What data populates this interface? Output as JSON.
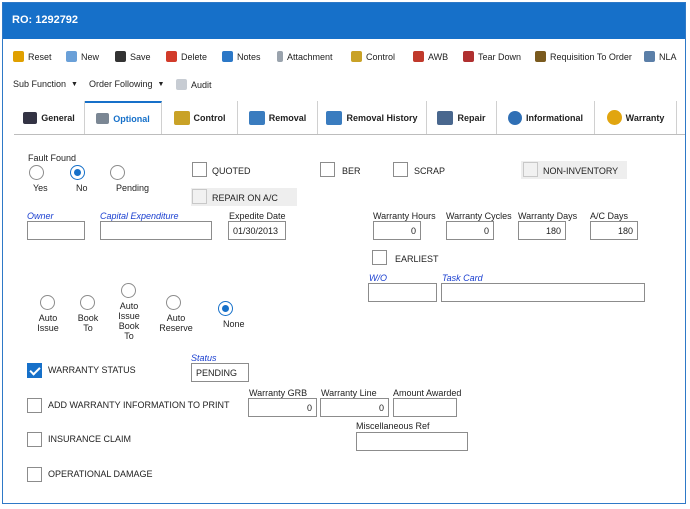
{
  "window": {
    "title": "RO: 1292792",
    "corner_glyph": "("
  },
  "toolbar": {
    "row1": [
      "Reset",
      "New",
      "Save",
      "Delete",
      "Notes",
      "Attachment",
      "Control",
      "AWB",
      "Tear Down",
      "Requisition To Order",
      "NLA"
    ],
    "row2": [
      "Sub Function",
      "Order Following",
      "Audit"
    ]
  },
  "tabs": [
    "General",
    "Optional",
    "Control",
    "Removal",
    "Removal History",
    "Repair",
    "Informational",
    "Warranty"
  ],
  "active_tab": "Optional",
  "fault_found": {
    "label": "Fault Found",
    "options": [
      "Yes",
      "No",
      "Pending"
    ],
    "selected": "No"
  },
  "checkboxes": {
    "quoted": "QUOTED",
    "ber": "BER",
    "scrap": "SCRAP",
    "non_inventory": "NON-INVENTORY",
    "repair_on_ac": "REPAIR ON A/C",
    "earliest": "EARLIEST"
  },
  "fields": {
    "owner": {
      "label": "Owner",
      "value": ""
    },
    "capital_expenditure": {
      "label": "Capital Expenditure",
      "value": ""
    },
    "expedite_date": {
      "label": "Expedite Date",
      "value": "01/30/2013"
    },
    "warranty_hours": {
      "label": "Warranty Hours",
      "value": "0"
    },
    "warranty_cycles": {
      "label": "Warranty Cycles",
      "value": "0"
    },
    "warranty_days": {
      "label": "Warranty Days",
      "value": "180"
    },
    "ac_days": {
      "label": "A/C Days",
      "value": "180"
    },
    "wo": {
      "label": "W/O",
      "value": ""
    },
    "task_card": {
      "label": "Task Card",
      "value": ""
    },
    "status": {
      "label": "Status",
      "value": "PENDING"
    },
    "warranty_grb": {
      "label": "Warranty GRB",
      "value": "0"
    },
    "warranty_line": {
      "label": "Warranty Line",
      "value": "0"
    },
    "amount_awarded": {
      "label": "Amount Awarded",
      "value": ""
    },
    "misc_ref": {
      "label": "Miscellaneous Ref",
      "value": ""
    }
  },
  "auto_options": {
    "options": [
      "Auto\nIssue",
      "Book\nTo",
      "Auto\nIssue\nBook\nTo",
      "Auto\nReserve",
      "None"
    ],
    "selected": "None"
  },
  "warranty_flags": {
    "warranty_status": {
      "label": "WARRANTY STATUS",
      "checked": true
    },
    "add_warranty_info": {
      "label": "ADD WARRANTY INFORMATION TO PRINT",
      "checked": false
    },
    "insurance_claim": {
      "label": "INSURANCE CLAIM",
      "checked": false
    },
    "operational_damage": {
      "label": "OPERATIONAL DAMAGE",
      "checked": false
    }
  },
  "colors": {
    "accent": "#1670c9",
    "label_blue": "#1a3fd0"
  }
}
